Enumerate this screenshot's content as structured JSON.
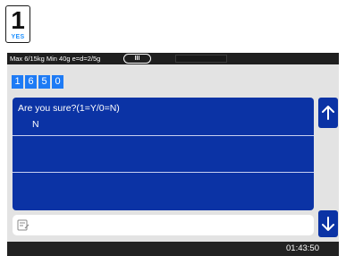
{
  "yes_key": {
    "digit": "1",
    "label": "YES"
  },
  "status": {
    "spec_text": "Max 6/15kg Min 40g e=d=2/5g",
    "accuracy_class": "III"
  },
  "code_digits": [
    "1",
    "6",
    "5",
    "0"
  ],
  "dialog": {
    "prompt": "Are you sure?(1=Y/0=N)",
    "answer": "N"
  },
  "input": {
    "value": ""
  },
  "clock": "01:43:50",
  "colors": {
    "panel": "#0b33a5",
    "digit_bg": "#1e7bf5",
    "yes_label": "#1e90ff",
    "status_bar": "#1f1f1f"
  },
  "icons": {
    "up": "arrow-up-icon",
    "down": "arrow-down-icon",
    "input": "edit-note-icon"
  }
}
